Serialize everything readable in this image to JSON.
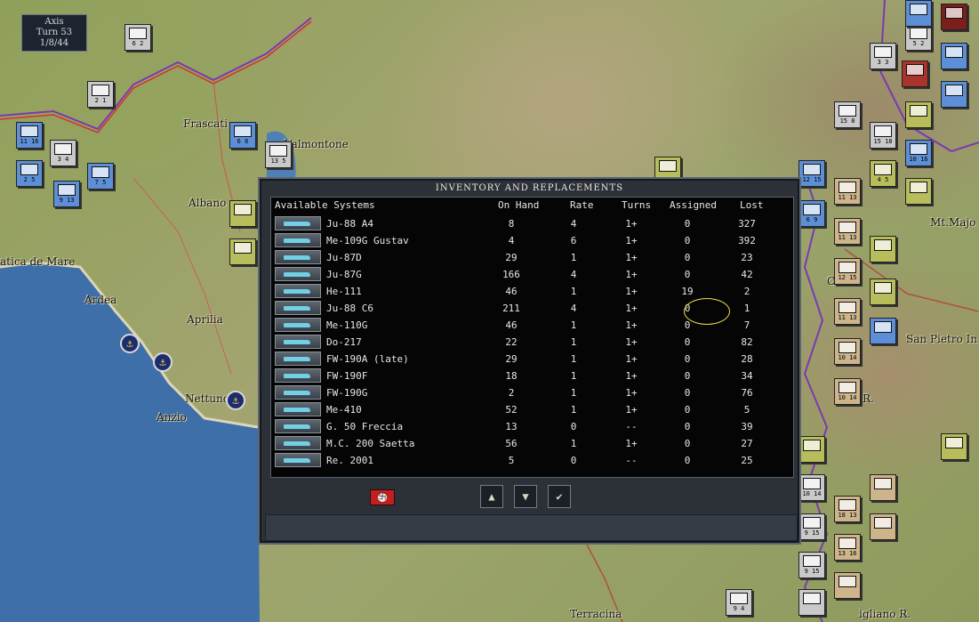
{
  "status": {
    "side": "Axis",
    "turn": "Turn 53",
    "date": "1/8/44"
  },
  "map_labels": [
    "Frascati",
    "Valmontone",
    "Albano",
    "Aprilia",
    "Ardea",
    "Nettuno",
    "Anzio",
    "atica de Mare",
    "Mt.Majo",
    "San Pietro In",
    "Terracina",
    "Castel",
    "R.",
    "igliano R."
  ],
  "dialog": {
    "title": "INVENTORY AND REPLACEMENTS",
    "headers": [
      "Available Systems",
      "On Hand",
      "Rate",
      "Turns",
      "Assigned",
      "Lost"
    ],
    "rows": [
      {
        "name": "Ju-88 A4",
        "on_hand": "8",
        "rate": "4",
        "turns": "1+",
        "assigned": "0",
        "lost": "327"
      },
      {
        "name": "Me-109G Gustav",
        "on_hand": "4",
        "rate": "6",
        "turns": "1+",
        "assigned": "0",
        "lost": "392"
      },
      {
        "name": "Ju-87D",
        "on_hand": "29",
        "rate": "1",
        "turns": "1+",
        "assigned": "0",
        "lost": "23"
      },
      {
        "name": "Ju-87G",
        "on_hand": "166",
        "rate": "4",
        "turns": "1+",
        "assigned": "0",
        "lost": "42"
      },
      {
        "name": "He-111",
        "on_hand": "46",
        "rate": "1",
        "turns": "1+",
        "assigned": "19",
        "lost": "2"
      },
      {
        "name": "Ju-88 C6",
        "on_hand": "211",
        "rate": "4",
        "turns": "1+",
        "assigned": "0",
        "lost": "1"
      },
      {
        "name": "Me-110G",
        "on_hand": "46",
        "rate": "1",
        "turns": "1+",
        "assigned": "0",
        "lost": "7"
      },
      {
        "name": "Do-217",
        "on_hand": "22",
        "rate": "1",
        "turns": "1+",
        "assigned": "0",
        "lost": "82"
      },
      {
        "name": "FW-190A (late)",
        "on_hand": "29",
        "rate": "1",
        "turns": "1+",
        "assigned": "0",
        "lost": "28"
      },
      {
        "name": "FW-190F",
        "on_hand": "18",
        "rate": "1",
        "turns": "1+",
        "assigned": "0",
        "lost": "34"
      },
      {
        "name": "FW-190G",
        "on_hand": "2",
        "rate": "1",
        "turns": "1+",
        "assigned": "0",
        "lost": "76"
      },
      {
        "name": "Me-410",
        "on_hand": "52",
        "rate": "1",
        "turns": "1+",
        "assigned": "0",
        "lost": "5"
      },
      {
        "name": "G. 50 Freccia",
        "on_hand": "13",
        "rate": "0",
        "turns": "--",
        "assigned": "0",
        "lost": "39"
      },
      {
        "name": "M.C. 200 Saetta",
        "on_hand": "56",
        "rate": "1",
        "turns": "1+",
        "assigned": "0",
        "lost": "27"
      },
      {
        "name": "Re. 2001",
        "on_hand": "5",
        "rate": "0",
        "turns": "--",
        "assigned": "0",
        "lost": "25"
      }
    ],
    "controls": {
      "flag_icon": "nation-flag-icon",
      "up": "▲",
      "down": "▼",
      "ok": "✔"
    }
  },
  "colors": {
    "allied_unit": "#5c8fd6",
    "axis_unit": "#b6bd5a",
    "sea": "#3f6fa8",
    "highlight": "#e8e24a"
  }
}
